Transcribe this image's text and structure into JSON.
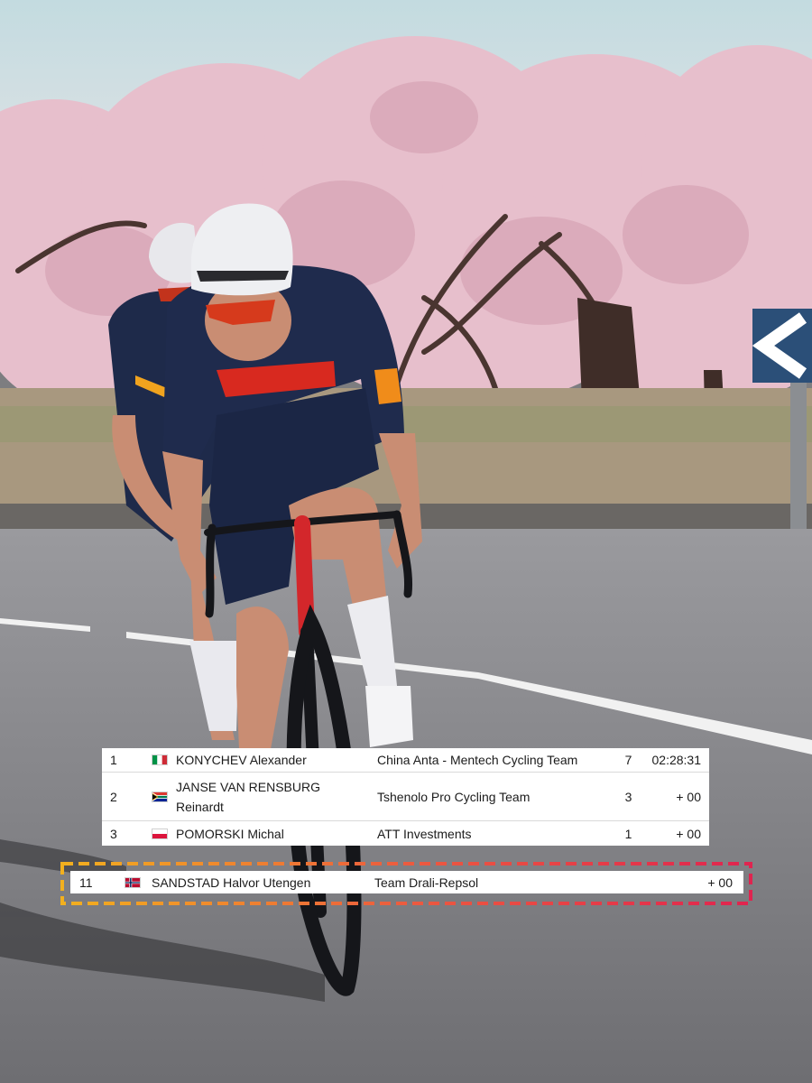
{
  "results_table": {
    "rows": [
      {
        "position": "1",
        "flag": "flag-italy-icon",
        "name_line1": "KONYCHEV Alexander",
        "name_line2": "",
        "team": "China Anta - Mentech Cycling Team",
        "points": "7",
        "time": "02:28:31"
      },
      {
        "position": "2",
        "flag": "flag-south-africa-icon",
        "name_line1": "JANSE VAN RENSBURG",
        "name_line2": "Reinardt",
        "team": "Tshenolo Pro Cycling Team",
        "points": "3",
        "time": "+ 00"
      },
      {
        "position": "3",
        "flag": "flag-poland-icon",
        "name_line1": "POMORSKI Michal",
        "name_line2": "",
        "team": "ATT Investments",
        "points": "1",
        "time": "+ 00"
      }
    ]
  },
  "highlight_row": {
    "position": "11",
    "flag": "flag-norway-icon",
    "name": "SANDSTAD Halvor Utengen",
    "team": "Team Drali-Repsol",
    "time": "+ 00",
    "frame_gradient": [
      "#f2b01e",
      "#ec5b3f",
      "#e0244f"
    ]
  }
}
